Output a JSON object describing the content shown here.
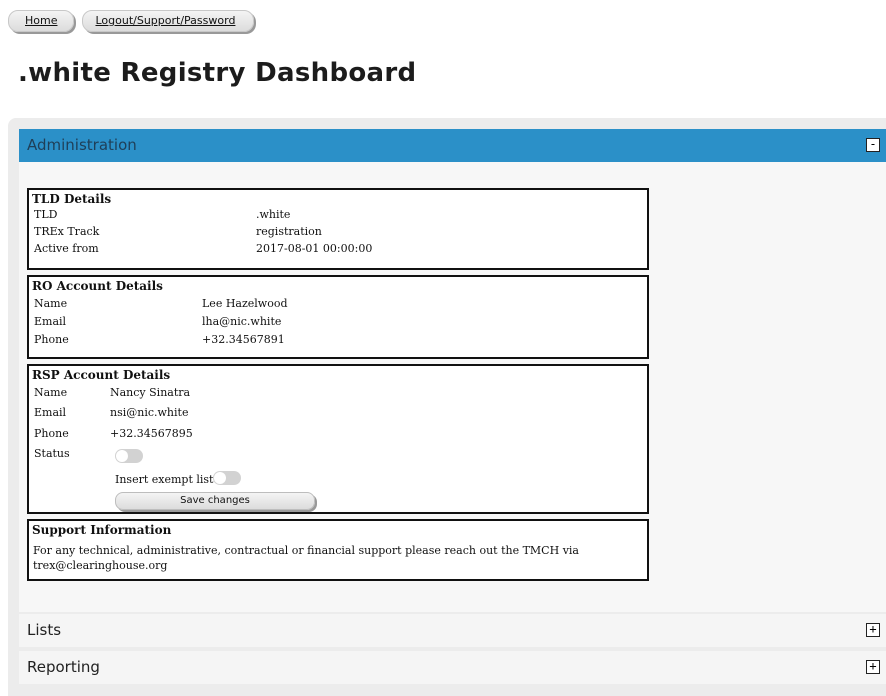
{
  "nav": {
    "home": "Home",
    "logout": "Logout/Support/Password"
  },
  "page_title": ".white Registry Dashboard",
  "sections": {
    "administration": {
      "label": "Administration",
      "toggle": "-"
    },
    "lists": {
      "label": "Lists",
      "toggle": "+"
    },
    "reporting": {
      "label": "Reporting",
      "toggle": "+"
    }
  },
  "tld_details": {
    "title": "TLD Details",
    "rows": [
      {
        "label": "TLD",
        "value": ".white"
      },
      {
        "label": "TREx Track",
        "value": "registration"
      },
      {
        "label": "Active from",
        "value": "2017-08-01 00:00:00"
      }
    ]
  },
  "ro_account": {
    "title": "RO Account Details",
    "rows": [
      {
        "label": "Name",
        "value": "Lee Hazelwood"
      },
      {
        "label": "Email",
        "value": "lha@nic.white"
      },
      {
        "label": "Phone",
        "value": "+32.34567891"
      }
    ]
  },
  "rsp_account": {
    "title": "RSP Account Details",
    "rows": [
      {
        "label": "Name",
        "value": "Nancy Sinatra"
      },
      {
        "label": "Email",
        "value": "nsi@nic.white"
      },
      {
        "label": "Phone",
        "value": "+32.34567895"
      },
      {
        "label": "Status",
        "value": ""
      }
    ],
    "status_on": false,
    "insert_exempt_label": "Insert exempt list",
    "insert_exempt_on": false,
    "save_label": "Save changes"
  },
  "support": {
    "title": "Support Information",
    "text": "For any technical, administrative, contractual or financial support please reach out the TMCH via trex@clearinghouse.org"
  },
  "colors": {
    "header_blue": "#2b90c8",
    "panel_bg": "#ececec",
    "toggle_off": "#d2d2d2"
  }
}
